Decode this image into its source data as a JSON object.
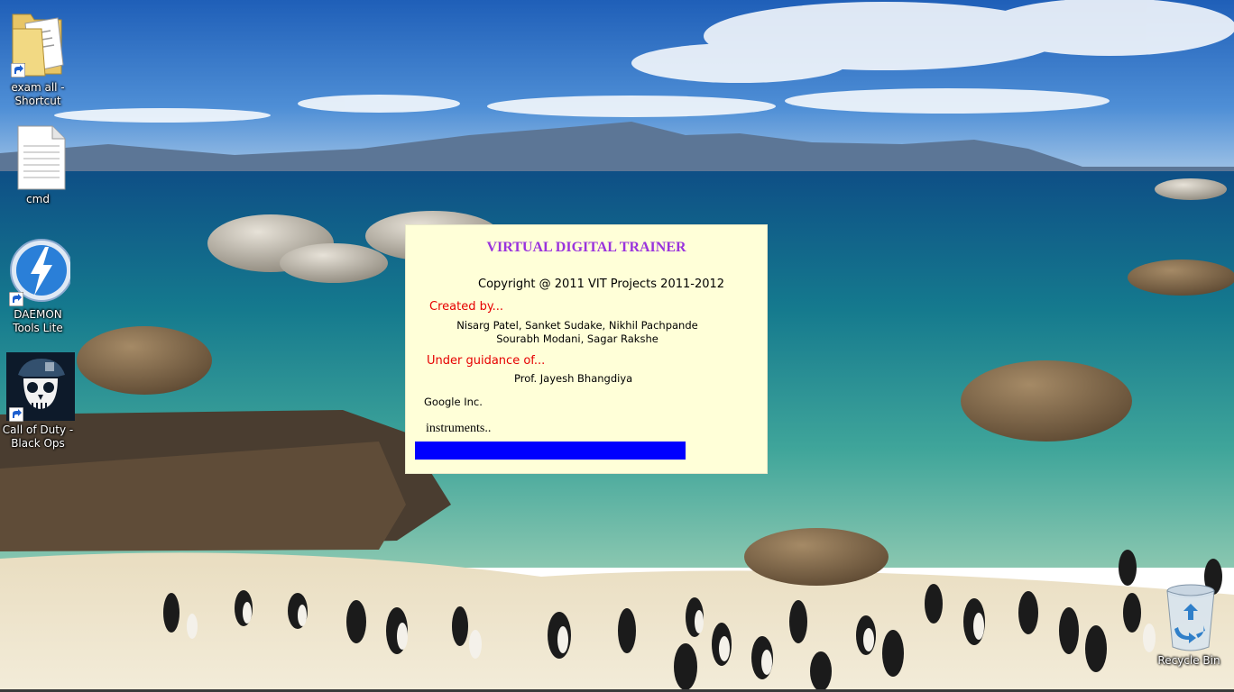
{
  "desktop": {
    "icons": [
      {
        "label": "exam all -\nShortcut",
        "icon": "folder-icon"
      },
      {
        "label": "cmd",
        "icon": "text-file-icon"
      },
      {
        "label": "DAEMON\nTools Lite",
        "icon": "daemon-tools-icon"
      },
      {
        "label": "Call of Duty -\nBlack Ops",
        "icon": "skull-game-icon"
      },
      {
        "label": "Recycle Bin",
        "icon": "recycle-bin-icon"
      }
    ]
  },
  "splash": {
    "title": "VIRTUAL DIGITAL TRAINER",
    "copyright": "Copyright @ 2011 VIT Projects 2011-2012",
    "created_by_label": "Created by...",
    "creators_line1": "Nisarg Patel, Sanket Sudake, Nikhil Pachpande",
    "creators_line2": "Sourabh Modani, Sagar Rakshe",
    "guidance_label": "Under guidance of...",
    "guide": "Prof. Jayesh Bhangdiya",
    "company": "Google Inc.",
    "status": "instruments..",
    "progress_percent": 79,
    "colors": {
      "background": "#ffffd8",
      "title": "#9a33dd",
      "section_labels": "#e60000",
      "progress": "#0000ff"
    }
  }
}
